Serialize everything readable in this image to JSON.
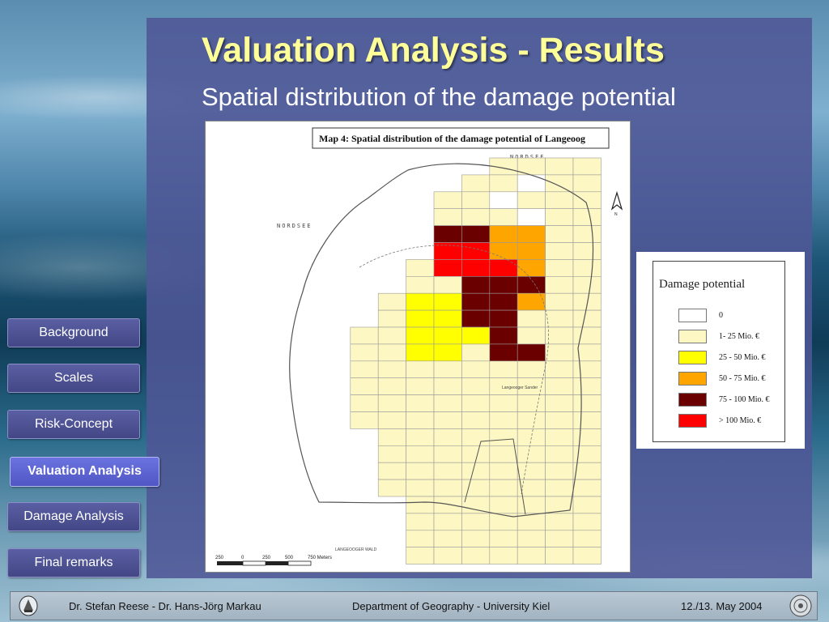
{
  "slide": {
    "title": "Valuation Analysis - Results",
    "subtitle": "Spatial distribution of the damage potential"
  },
  "map": {
    "title": "Map 4: Spatial distribution of the damage potential of Langeoog",
    "label_sea_north": "NORDSEE",
    "label_sea_west": "NORDSEE",
    "label_south": "LANGEOOGER WALD",
    "label_place": "Langeooger Sander",
    "north_symbol": "N",
    "scale_labels": [
      "250",
      "0",
      "250",
      "500",
      "750 Meters"
    ],
    "cell_classes": [
      "_______..........",
      "______..a........",
      "_____..a.........",
      "_____...a........",
      "_____ddoo........",
      "_____rroo........",
      "____.rrro........",
      "____..ddd........",
      "___.yyddo........",
      "___.yydd.........",
      "__..yyyd.........",
      "__..yy.dd........",
      "__...............",
      "__...............",
      "__...............",
      "__...............",
      "___..............",
      "___..............",
      "___..............",
      "___..............",
      "____.............",
      "____.............",
      "____.............",
      "____............."
    ]
  },
  "legend": {
    "title": "Damage potential",
    "items": [
      {
        "label": "0",
        "color": "#ffffff"
      },
      {
        "label": "1- 25 Mio. €",
        "color": "#fdf7c3"
      },
      {
        "label": "25 - 50 Mio. €",
        "color": "#ffff00"
      },
      {
        "label": "50 - 75 Mio. €",
        "color": "#ffa500"
      },
      {
        "label": "75 - 100 Mio. €",
        "color": "#6b0000"
      },
      {
        "label": "> 100 Mio. €",
        "color": "#ff0000"
      }
    ]
  },
  "nav": {
    "items": [
      {
        "label": "Background",
        "active": false
      },
      {
        "label": "Scales",
        "active": false
      },
      {
        "label": "Risk-Concept",
        "active": false
      },
      {
        "label": "Valuation Analysis",
        "active": true
      },
      {
        "label": "Damage Analysis",
        "active": false
      },
      {
        "label": "Final remarks",
        "active": false
      }
    ]
  },
  "footer": {
    "authors": "Dr. Stefan Reese - Dr. Hans-Jörg Markau",
    "department": "Department of Geography - University Kiel",
    "date": "12./13. May 2004"
  },
  "colors": {
    "title": "#ffff99",
    "panel": "#4e5696",
    "nav_active": "#5a61d0"
  }
}
